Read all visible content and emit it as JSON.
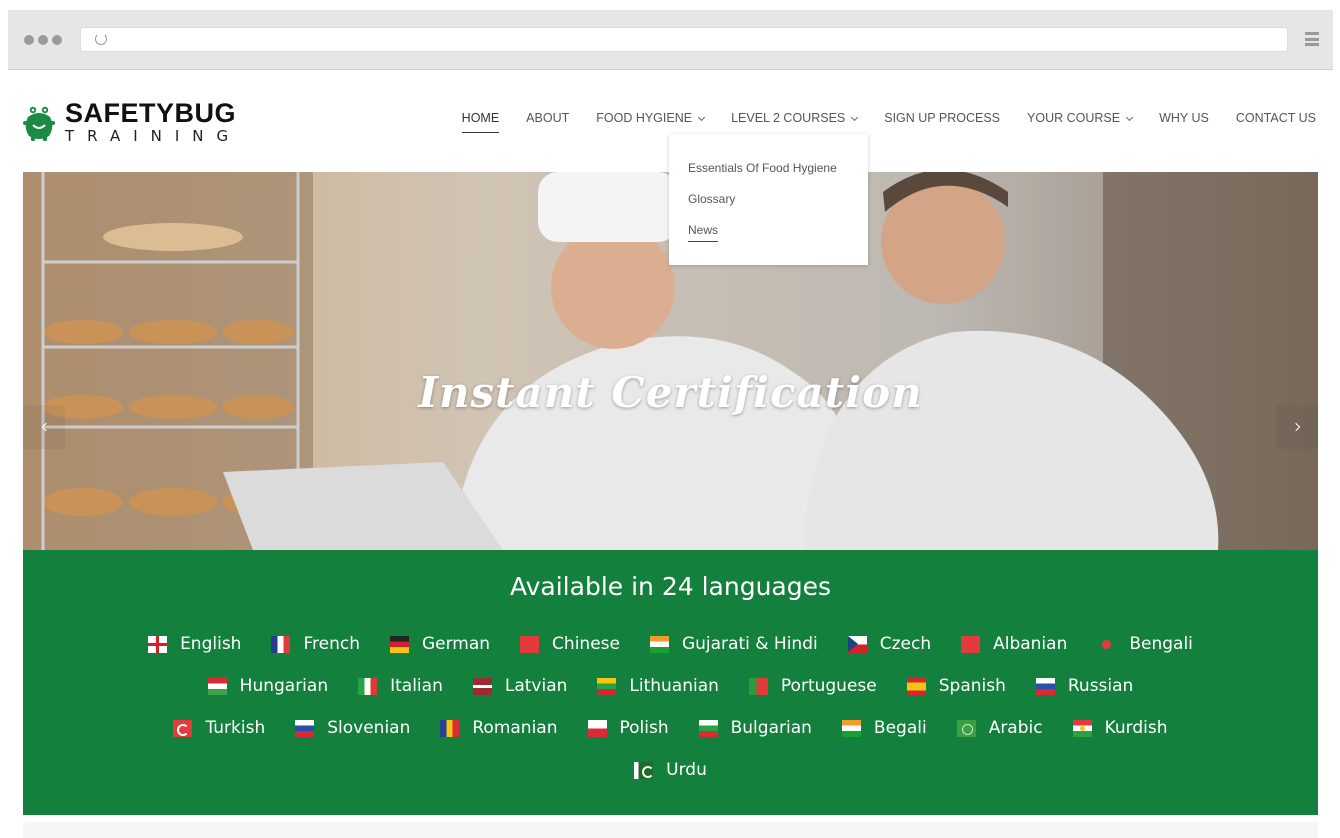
{
  "colors": {
    "accent_green": "#14803d",
    "nav_text": "#555555",
    "browser_chrome": "#e6e6e6"
  },
  "browser": {
    "icons": [
      "reload-icon",
      "menu-icon"
    ]
  },
  "logo": {
    "title": "SAFETYBUG",
    "subtitle": "TRAINING",
    "icon": "bug-mascot-icon"
  },
  "nav": {
    "items": [
      {
        "label": "HOME",
        "active": true,
        "dropdown": false
      },
      {
        "label": "ABOUT",
        "active": false,
        "dropdown": false
      },
      {
        "label": "FOOD HYGIENE",
        "active": false,
        "dropdown": true
      },
      {
        "label": "LEVEL 2 COURSES",
        "active": false,
        "dropdown": true
      },
      {
        "label": "SIGN UP PROCESS",
        "active": false,
        "dropdown": false
      },
      {
        "label": "YOUR COURSE",
        "active": false,
        "dropdown": true
      },
      {
        "label": "WHY US",
        "active": false,
        "dropdown": false
      },
      {
        "label": "CONTACT US",
        "active": false,
        "dropdown": false
      }
    ]
  },
  "dropdown": {
    "items": [
      {
        "label": "Essentials Of Food Hygiene"
      },
      {
        "label": "Glossary"
      },
      {
        "label": "News"
      }
    ]
  },
  "hero": {
    "title": "Instant Certification",
    "prev_icon": "chevron-left-icon",
    "next_icon": "chevron-right-icon"
  },
  "languages": {
    "heading": "Available in 24 languages",
    "rows": [
      [
        {
          "label": "English",
          "flag": "english"
        },
        {
          "label": "French",
          "flag": "france"
        },
        {
          "label": "German",
          "flag": "germany"
        },
        {
          "label": "Chinese",
          "flag": "china"
        },
        {
          "label": "Gujarati & Hindi",
          "flag": "india"
        },
        {
          "label": "Czech",
          "flag": "czech"
        },
        {
          "label": "Albanian",
          "flag": "albania"
        },
        {
          "label": "Bengali",
          "flag": "bangladesh"
        }
      ],
      [
        {
          "label": "Hungarian",
          "flag": "hungary"
        },
        {
          "label": "Italian",
          "flag": "italy"
        },
        {
          "label": "Latvian",
          "flag": "latvia"
        },
        {
          "label": "Lithuanian",
          "flag": "lithuania"
        },
        {
          "label": "Portuguese",
          "flag": "portugal"
        },
        {
          "label": "Spanish",
          "flag": "spain"
        },
        {
          "label": "Russian",
          "flag": "russia"
        }
      ],
      [
        {
          "label": "Turkish",
          "flag": "turkey"
        },
        {
          "label": "Slovenian",
          "flag": "slovenia"
        },
        {
          "label": "Romanian",
          "flag": "romania"
        },
        {
          "label": "Polish",
          "flag": "poland"
        },
        {
          "label": "Bulgarian",
          "flag": "bulgaria"
        },
        {
          "label": "Begali",
          "flag": "india"
        },
        {
          "label": "Arabic",
          "flag": "arabic"
        },
        {
          "label": "Kurdish",
          "flag": "kurdistan"
        }
      ],
      [
        {
          "label": "Urdu",
          "flag": "pakistan"
        }
      ]
    ]
  }
}
